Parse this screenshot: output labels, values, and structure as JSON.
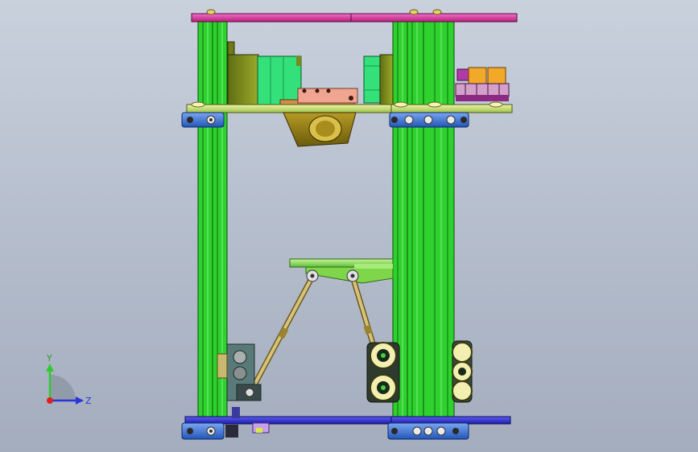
{
  "viewport": {
    "background_top": "#c9d1dd",
    "background_bottom": "#a4adbd"
  },
  "colors": {
    "frame_green": "#2fd12f",
    "frame_green_dark": "#1e8f1e",
    "top_plate_magenta": "#d4288f",
    "bottom_plate_blue": "#2a2ad0",
    "bracket_blue": "#3a6fd0",
    "motor_olive": "#7a8a1a",
    "motor_green": "#33e07a",
    "platform_green": "#9be36a",
    "rod_tan": "#c9b56a",
    "wheel_cream": "#f3efb0",
    "hopper_olive": "#8b7a18",
    "board_orange": "#f2a92a",
    "board_purple": "#b23aa8"
  },
  "triad": {
    "y_label": "Y",
    "z_label": "Z",
    "y_color": "#2ecc2e",
    "z_color": "#2b35d8",
    "origin_color": "#e02020"
  }
}
